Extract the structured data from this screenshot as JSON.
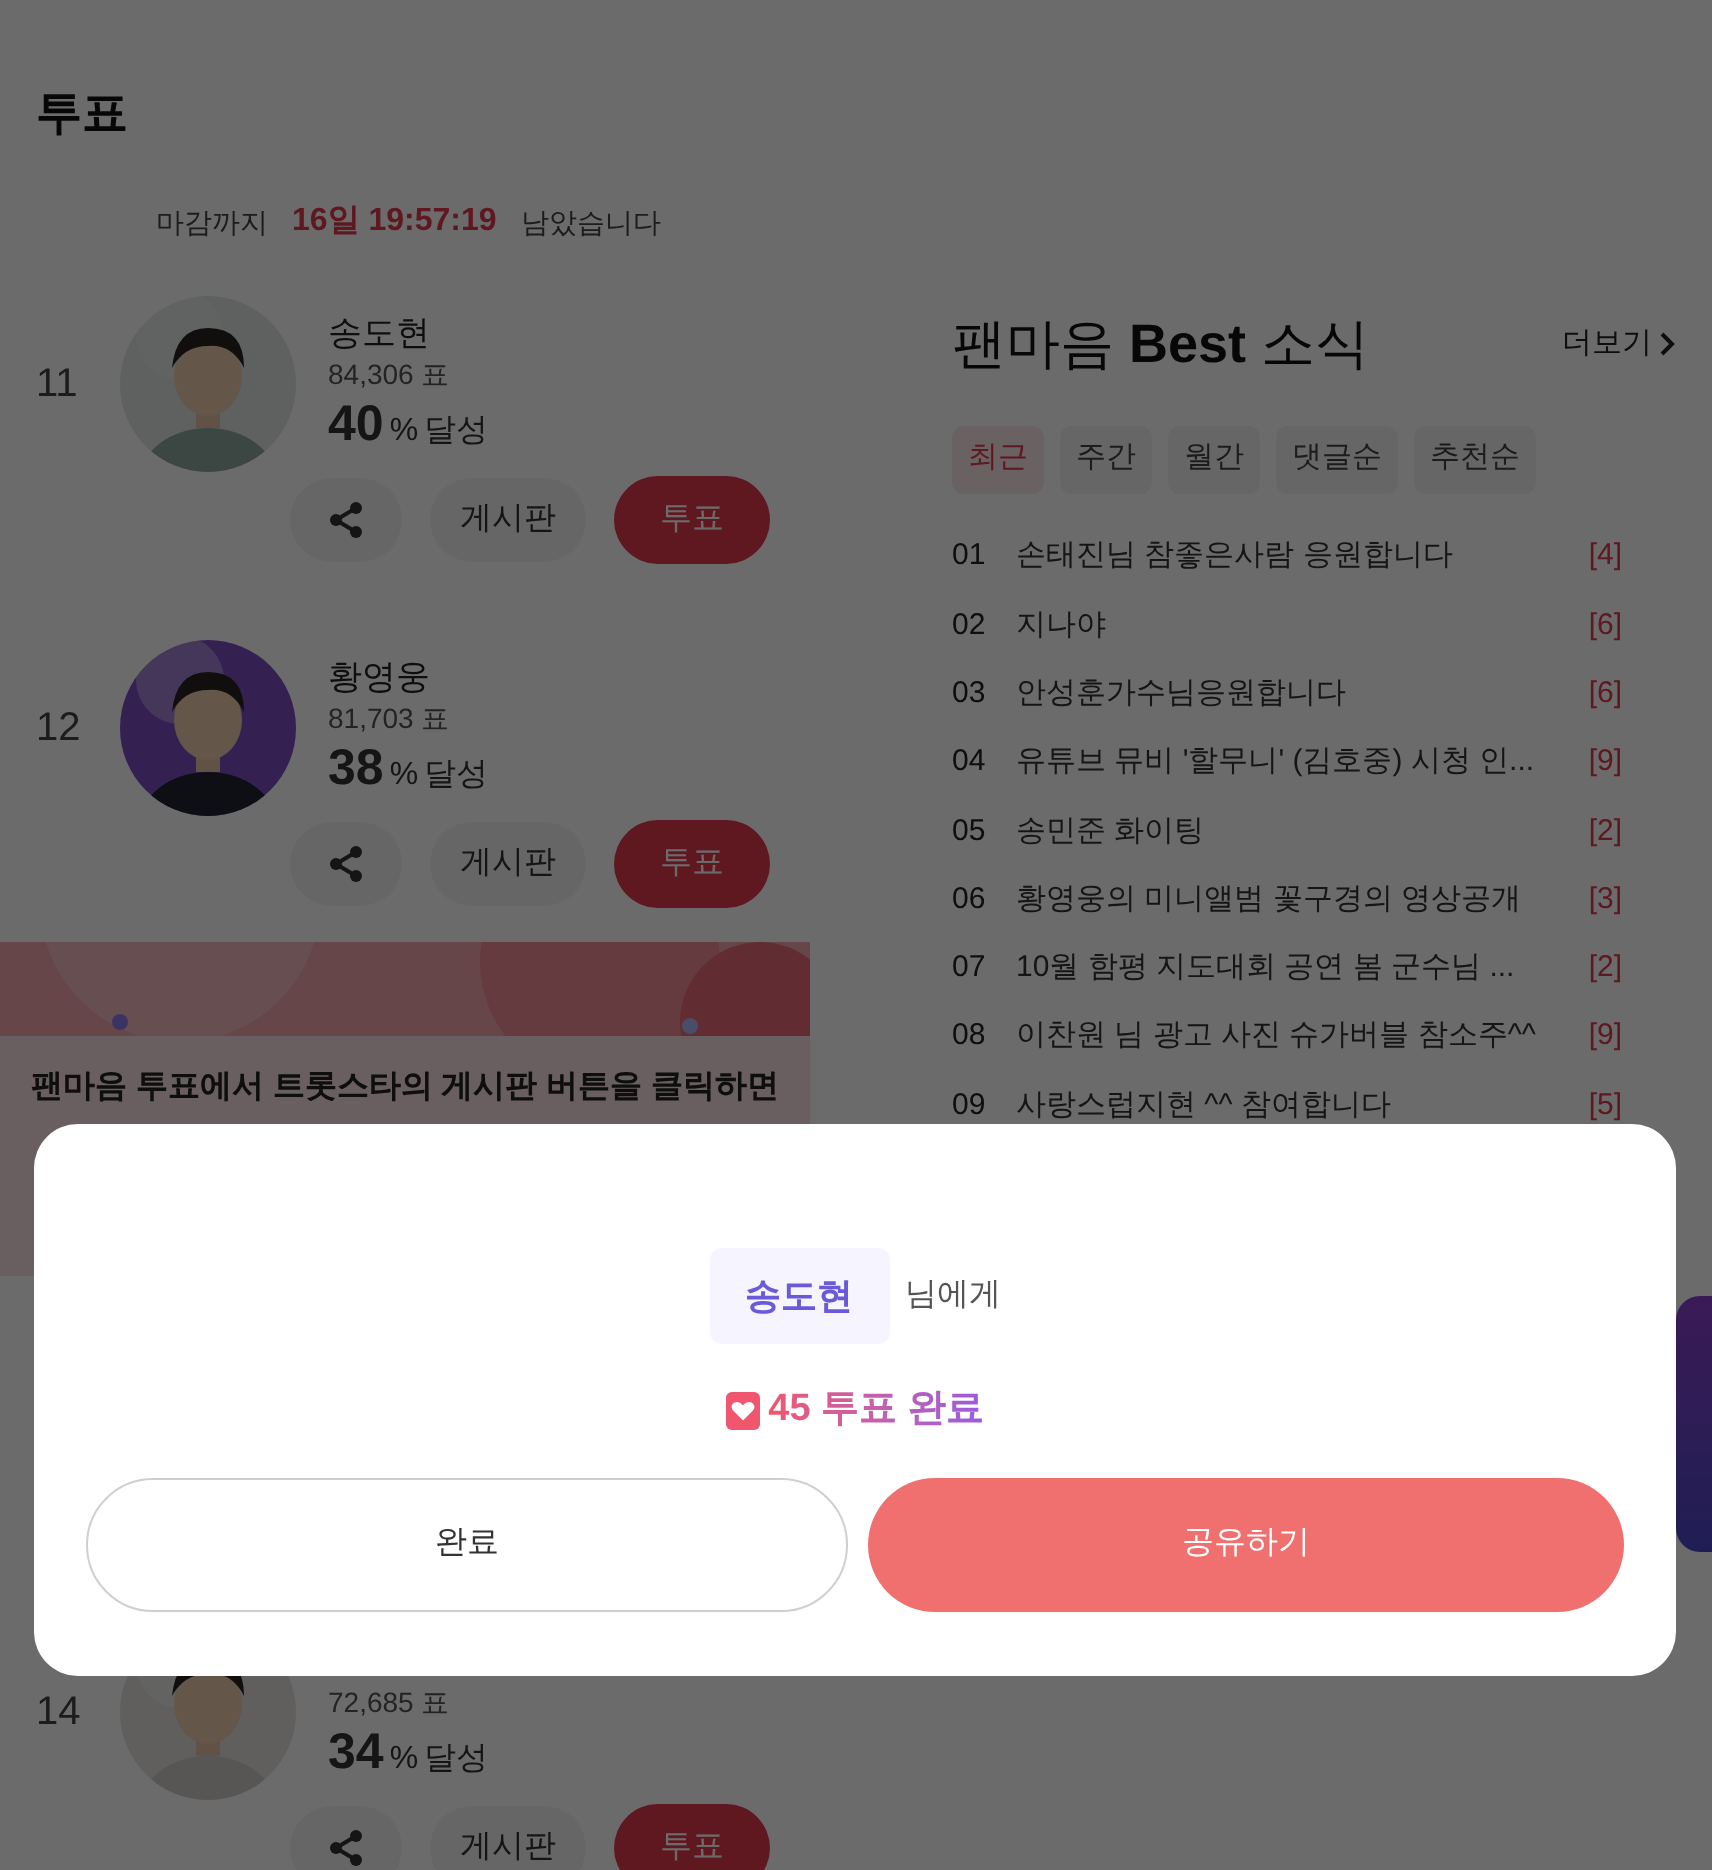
{
  "page_title": "투표",
  "deadline": {
    "prefix": "마감까지",
    "time": "16일 19:57:19",
    "suffix": "남았습니다"
  },
  "candidates": [
    {
      "rank": "11",
      "name": "송도현",
      "votes": "84,306 표",
      "percent": "40",
      "unit": "%",
      "achieved": "달성",
      "board": "게시판",
      "vote": "투표"
    },
    {
      "rank": "12",
      "name": "황영웅",
      "votes": "81,703 표",
      "percent": "38",
      "unit": "%",
      "achieved": "달성",
      "board": "게시판",
      "vote": "투표"
    },
    {
      "rank": "14",
      "votes": "72,685 표",
      "percent": "34",
      "unit": "%",
      "achieved": "달성",
      "board": "게시판",
      "vote": "투표"
    }
  ],
  "banner": {
    "text": "팬마음 투표에서 트롯스타의 게시판 버튼을 클릭하면"
  },
  "news": {
    "title": "팬마음 **Best** 소식",
    "more": "더보기",
    "tabs": [
      {
        "label": "최근",
        "selected": true
      },
      {
        "label": "주간",
        "selected": false
      },
      {
        "label": "월간",
        "selected": false
      },
      {
        "label": "댓글순",
        "selected": false
      },
      {
        "label": "추천순",
        "selected": false
      }
    ],
    "items": [
      {
        "no": "01",
        "title": "손태진님 참좋은사람 응원합니다",
        "count": "[4]"
      },
      {
        "no": "02",
        "title": "지나야",
        "count": "[6]"
      },
      {
        "no": "03",
        "title": "안성훈가수님응원합니다",
        "count": "[6]"
      },
      {
        "no": "04",
        "title": "유튜브 뮤비 '할무니' (김호중) 시청 인...",
        "count": "[9]"
      },
      {
        "no": "05",
        "title": "송민준 화이팅",
        "count": "[2]"
      },
      {
        "no": "06",
        "title": "황영웅의 미니앨범 꽃구경의 영상공개",
        "count": "[3]"
      },
      {
        "no": "07",
        "title": "10월 함평 지도대회 공연 봄 군수님 ...",
        "count": "[2]"
      },
      {
        "no": "08",
        "title": "이찬원 님 광고 사진 슈가버블 참소주^^",
        "count": "[9]"
      },
      {
        "no": "09",
        "title": "사랑스럽지현 ^^ 참여합니다",
        "count": "[5]"
      }
    ]
  },
  "modal": {
    "name": "송도현",
    "suffix": "님에게",
    "result": "45 투표 완료",
    "buttons": [
      {
        "label": "완료",
        "kind": "outline"
      },
      {
        "label": "공유하기",
        "kind": "primary"
      }
    ]
  }
}
